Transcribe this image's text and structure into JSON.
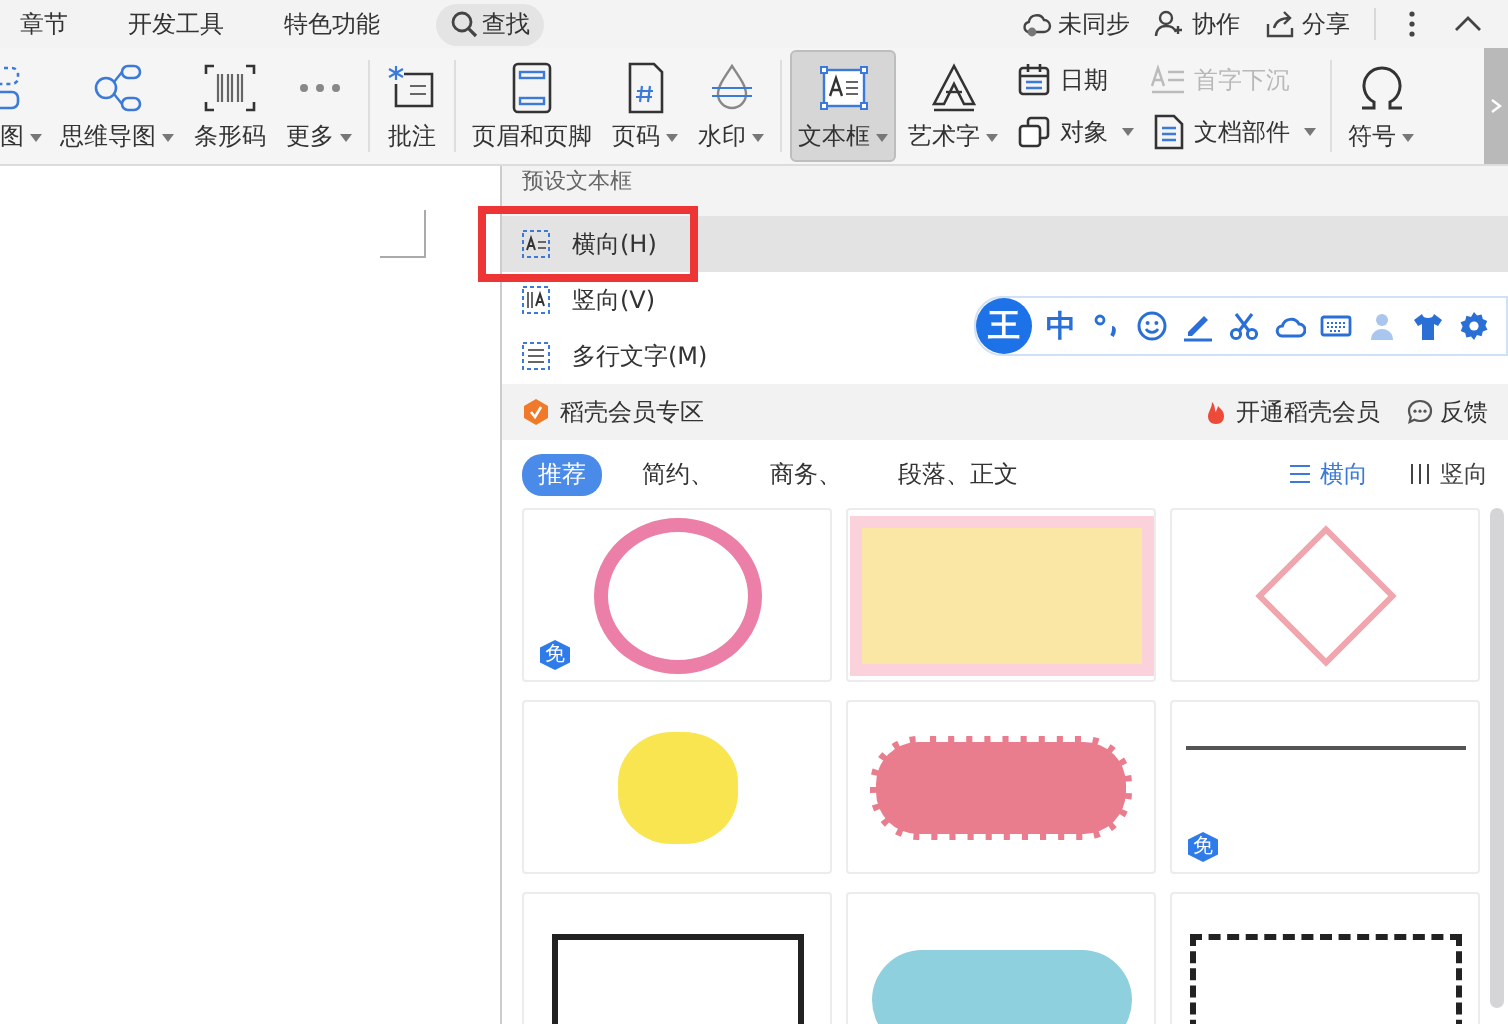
{
  "menu_tabs": [
    {
      "label": "章节"
    },
    {
      "label": "开发工具"
    },
    {
      "label": "特色功能"
    }
  ],
  "search": {
    "label": "查找"
  },
  "top_actions": [
    {
      "kind": "sync",
      "label": "未同步"
    },
    {
      "kind": "collab",
      "label": "协作"
    },
    {
      "kind": "share",
      "label": "分享"
    }
  ],
  "ribbon": {
    "groups": [
      {
        "buttons": [
          {
            "kind": "flowchart",
            "label": "图",
            "dropdown": true,
            "selected": false
          },
          {
            "kind": "mindmap",
            "label": "思维导图",
            "dropdown": true,
            "selected": false
          },
          {
            "kind": "barcode",
            "label": "条形码",
            "dropdown": false,
            "selected": false
          },
          {
            "kind": "more",
            "label": "更多",
            "dropdown": true,
            "selected": false
          }
        ]
      },
      {
        "buttons": [
          {
            "kind": "comment",
            "label": "批注",
            "dropdown": false,
            "selected": false
          }
        ]
      },
      {
        "buttons": [
          {
            "kind": "header",
            "label": "页眉和页脚",
            "dropdown": false,
            "selected": false
          },
          {
            "kind": "pagenum",
            "label": "页码",
            "dropdown": true,
            "selected": false
          },
          {
            "kind": "watermark",
            "label": "水印",
            "dropdown": true,
            "selected": false
          }
        ]
      },
      {
        "buttons": [
          {
            "kind": "textbox",
            "label": "文本框",
            "dropdown": true,
            "selected": true
          },
          {
            "kind": "wordart",
            "label": "艺术字",
            "dropdown": true,
            "selected": false
          },
          {
            "kind": "stack",
            "items": [
              {
                "kind": "date",
                "label": "日期",
                "dropdown": false,
                "disabled": false
              },
              {
                "kind": "object",
                "label": "对象",
                "dropdown": true,
                "disabled": false
              }
            ]
          },
          {
            "kind": "stack",
            "items": [
              {
                "kind": "dropcap",
                "label": "首字下沉",
                "dropdown": false,
                "disabled": true
              },
              {
                "kind": "docpart",
                "label": "文档部件",
                "dropdown": true,
                "disabled": false
              }
            ]
          }
        ]
      },
      {
        "buttons": [
          {
            "kind": "symbol",
            "label": "符号",
            "dropdown": true,
            "selected": false
          }
        ]
      }
    ]
  },
  "textbox_menu": {
    "title": "预设文本框",
    "items": [
      {
        "kind": "horizontal",
        "label": "横向(H)",
        "selected": true
      },
      {
        "kind": "vertical",
        "label": "竖向(V)",
        "selected": false
      },
      {
        "kind": "multiline",
        "label": "多行文字(M)",
        "selected": false
      }
    ],
    "member_bar": {
      "title": "稻壳会员专区",
      "upgrade": "开通稻壳会员",
      "feedback": "反馈"
    },
    "categories": [
      {
        "label": "推荐",
        "selected": true
      },
      {
        "label": "简约、",
        "selected": false
      },
      {
        "label": "商务、",
        "selected": false
      },
      {
        "label": "段落、正文",
        "selected": false
      }
    ],
    "orientations": [
      {
        "kind": "horizontal",
        "label": "横向",
        "selected": true
      },
      {
        "kind": "vertical",
        "label": "竖向",
        "selected": false
      }
    ],
    "templates": [
      {
        "kind": "bubble",
        "free": true,
        "badge": "免"
      },
      {
        "kind": "note",
        "free": false
      },
      {
        "kind": "diamond",
        "free": false
      },
      {
        "kind": "blob",
        "free": false
      },
      {
        "kind": "ribbon",
        "free": false
      },
      {
        "kind": "garland",
        "free": true,
        "badge": "免"
      },
      {
        "kind": "frame"
      },
      {
        "kind": "pill"
      },
      {
        "kind": "dashed"
      }
    ]
  },
  "ime_toolbar": {
    "logo": "王",
    "mode": "中"
  }
}
